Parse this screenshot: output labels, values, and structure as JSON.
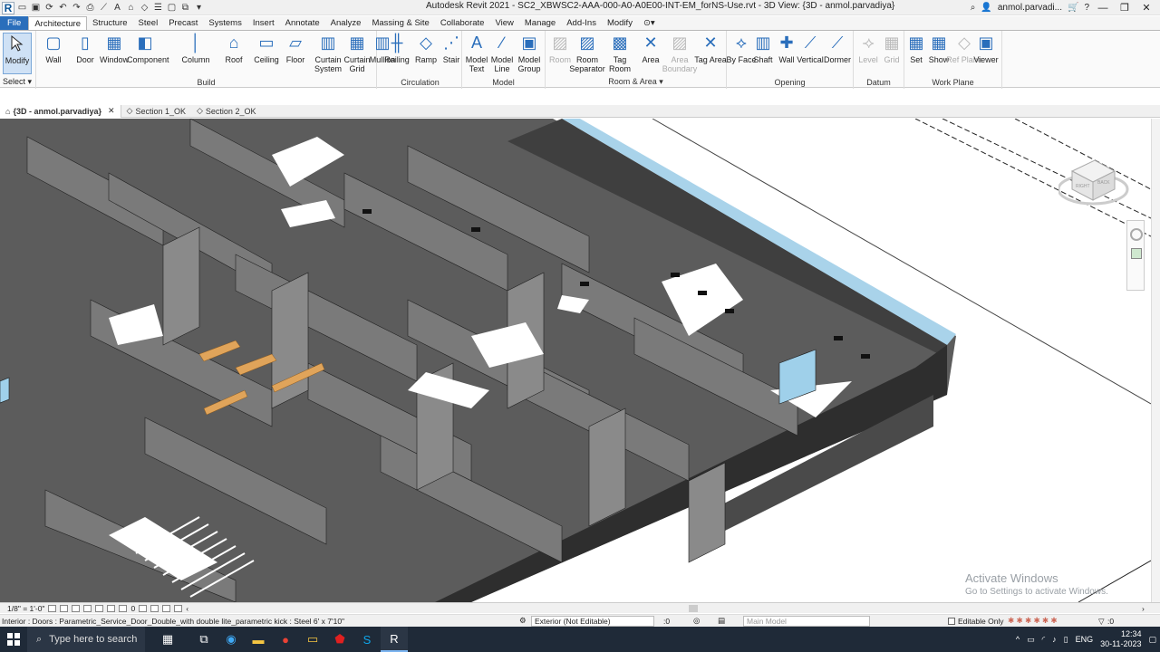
{
  "app": {
    "title": "Autodesk Revit 2021 - SC2_XBWSC2-AAA-000-A0-A0E00-INT-EM_forNS-Use.rvt - 3D View: {3D - anmol.parvadiya}",
    "user": "anmol.parvadi..."
  },
  "menu": {
    "tabs": [
      "File",
      "Architecture",
      "Structure",
      "Steel",
      "Precast",
      "Systems",
      "Insert",
      "Annotate",
      "Analyze",
      "Massing & Site",
      "Collaborate",
      "View",
      "Manage",
      "Add-Ins",
      "Modify"
    ],
    "active": "Architecture"
  },
  "ribbon": {
    "select": {
      "modify_label": "Modify",
      "group_label": "Select ▾"
    },
    "build": {
      "label": "Build",
      "buttons": [
        "Wall",
        "Door",
        "Window",
        "Component",
        "Column",
        "Roof",
        "Ceiling",
        "Floor",
        "Curtain System",
        "Curtain Grid",
        "Mullion"
      ]
    },
    "circulation": {
      "label": "Circulation",
      "buttons": [
        "Railing",
        "Ramp",
        "Stair"
      ]
    },
    "model": {
      "label": "Model",
      "buttons": [
        "Model Text",
        "Model Line",
        "Model Group"
      ]
    },
    "room_area": {
      "label": "Room & Area ▾",
      "buttons": [
        "Room",
        "Room Separator",
        "Tag Room",
        "Area",
        "Area Boundary",
        "Tag Area"
      ]
    },
    "opening": {
      "label": "Opening",
      "buttons": [
        "By Face",
        "Shaft",
        "Wall",
        "Vertical",
        "Dormer"
      ]
    },
    "datum": {
      "label": "Datum",
      "buttons": [
        "Level",
        "Grid"
      ]
    },
    "work_plane": {
      "label": "Work Plane",
      "buttons": [
        "Set",
        "Show",
        "Ref Plane",
        "Viewer"
      ]
    }
  },
  "view_tabs": [
    {
      "label": "{3D - anmol.parvadiya}",
      "active": true
    },
    {
      "label": "Section 1_OK",
      "active": false
    },
    {
      "label": "Section 2_OK",
      "active": false
    }
  ],
  "view_control": {
    "scale": "1/8\" = 1'-0\"",
    "detail": "0"
  },
  "status": {
    "message": "Interior : Doors : Parametric_Service_Door_Double_with double lite_parametric kick : Steel 6' x 7'10\"",
    "workset": "Exterior (Not Editable)",
    "selection_count": ":0",
    "design_option": "Main Model",
    "editable_only": "Editable Only",
    "filter": ":0"
  },
  "watermark": {
    "line1": "Activate Windows",
    "line2": "Go to Settings to activate Windows."
  },
  "viewcube": {
    "faces": [
      "RIGHT",
      "BACK"
    ]
  },
  "taskbar": {
    "search_placeholder": "Type here to search",
    "lang": "ENG",
    "time": "12:34",
    "date": "30-11-2023"
  }
}
